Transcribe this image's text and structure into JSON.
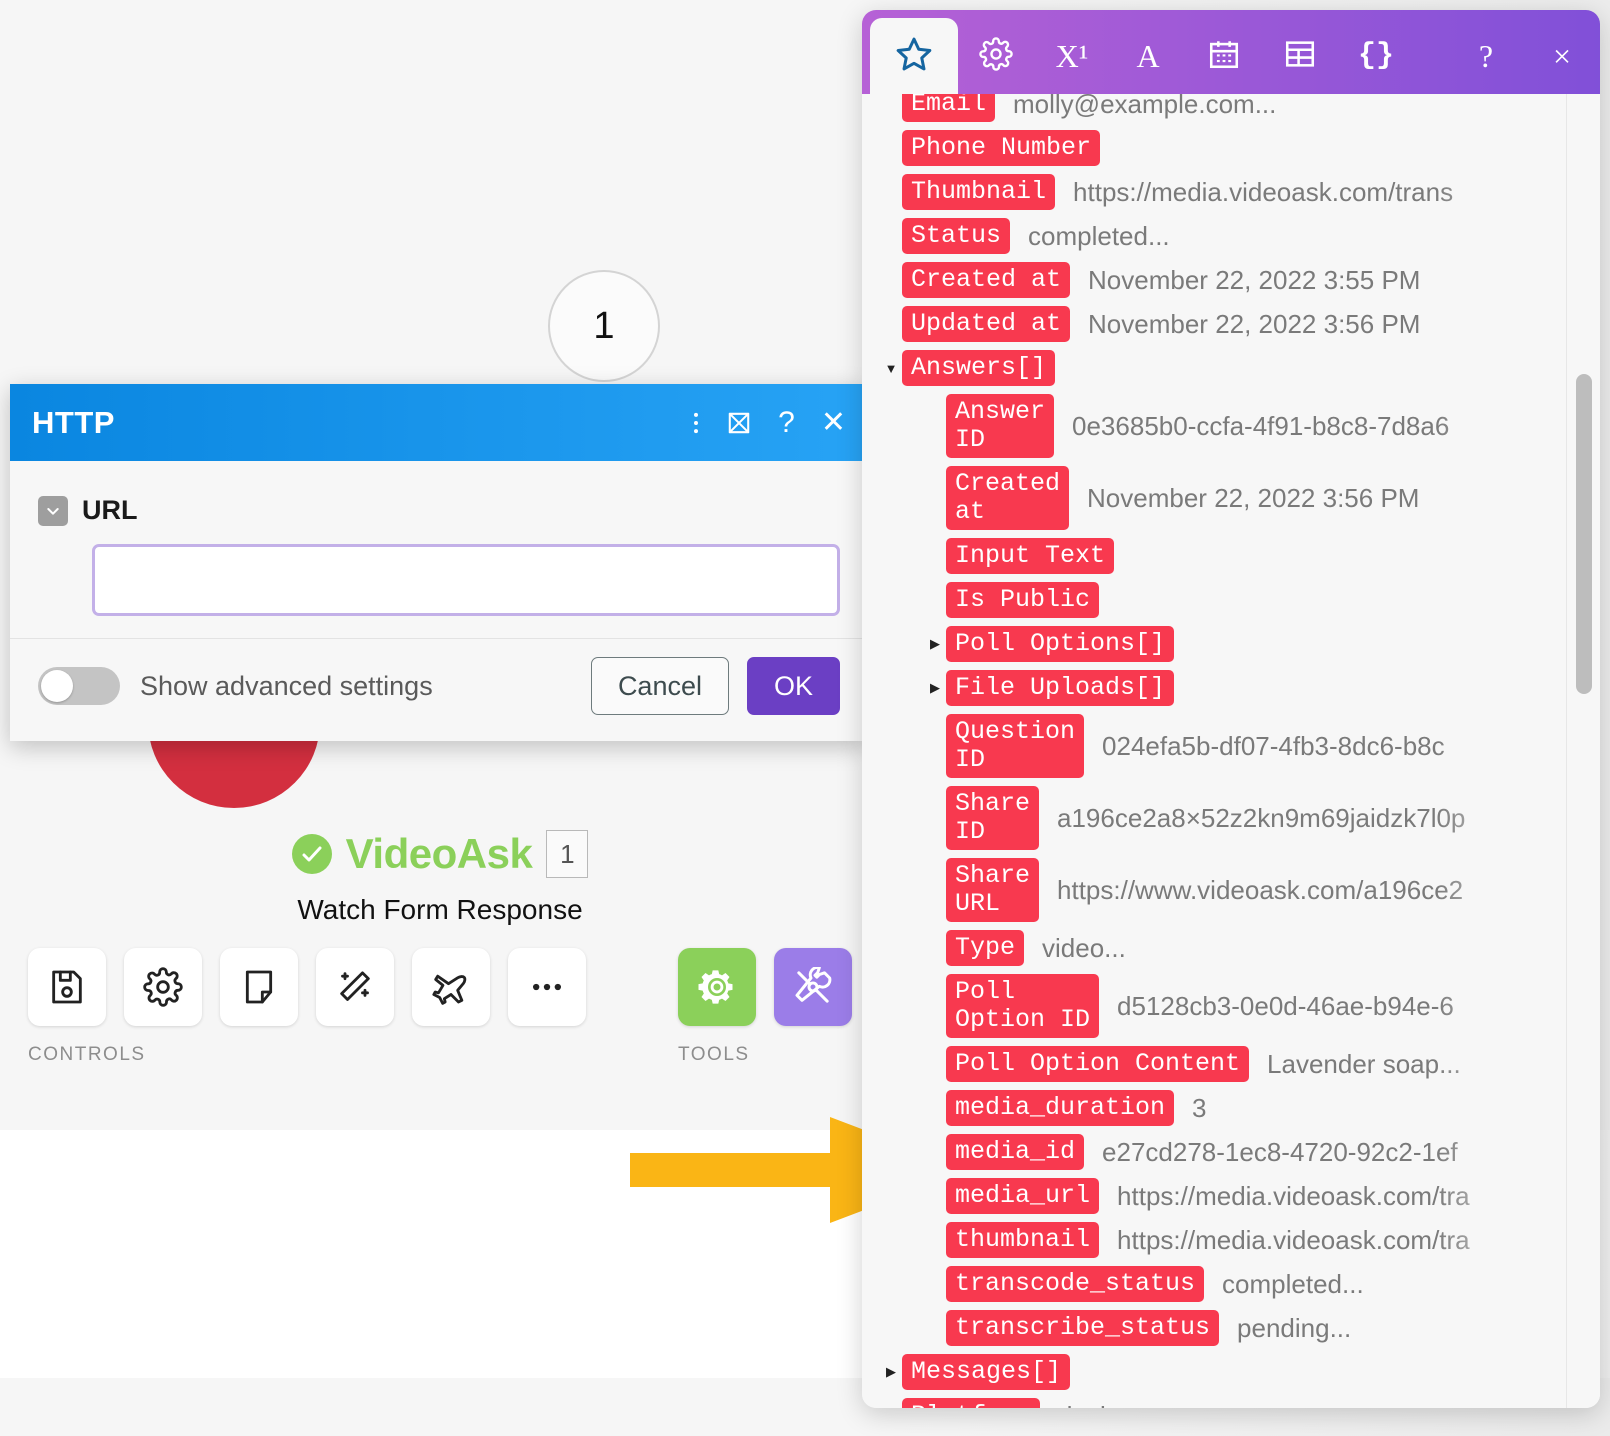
{
  "canvas": {
    "node_number": "1",
    "module": {
      "status_icon": "check-circle-icon",
      "name": "VideoAsk",
      "index": "1",
      "subtitle": "Watch Form Response",
      "controls_label": "CONTROLS",
      "tools_label": "TOOLS",
      "control_icons": [
        {
          "name": "save-icon",
          "label": "Save"
        },
        {
          "name": "gear-icon",
          "label": "Settings"
        },
        {
          "name": "note-icon",
          "label": "Note"
        },
        {
          "name": "magic-wand-icon",
          "label": "Auto-align"
        },
        {
          "name": "airplane-icon",
          "label": "Run this module only"
        },
        {
          "name": "more-ellipsis-icon",
          "label": "More"
        }
      ],
      "tool_icons": [
        {
          "name": "gear-tool-icon",
          "label": "Tools",
          "color": "#8bd05a"
        },
        {
          "name": "wrench-screwdriver-icon",
          "label": "Tools",
          "color": "#9b7de8"
        }
      ]
    }
  },
  "dialog": {
    "title": "HTTP",
    "header_icons": [
      {
        "name": "kebab-menu-icon",
        "label": "More options"
      },
      {
        "name": "expand-icon",
        "label": "Expand"
      },
      {
        "name": "help-question-icon",
        "label": "Help"
      },
      {
        "name": "close-icon",
        "label": "Close"
      }
    ],
    "url_field": {
      "label": "URL",
      "value": "",
      "placeholder": ""
    },
    "advanced_toggle_label": "Show advanced settings",
    "advanced_toggle_on": false,
    "cancel_label": "Cancel",
    "ok_label": "OK",
    "accent_color": "#6b3fc4",
    "header_color": "#0a86e0"
  },
  "panel": {
    "tabs": [
      {
        "name": "star-icon",
        "label": "Favorites",
        "active": true
      },
      {
        "name": "gear-icon",
        "label": "General functions",
        "active": false
      },
      {
        "name": "math-icon",
        "label": "X¹",
        "active": false
      },
      {
        "name": "text-icon",
        "label": "A",
        "active": false
      },
      {
        "name": "calendar-icon",
        "label": "Date & time",
        "active": false
      },
      {
        "name": "table-icon",
        "label": "Array",
        "active": false
      },
      {
        "name": "braces-icon",
        "label": "{}",
        "active": false
      },
      {
        "name": "help-question-icon",
        "label": "?",
        "active": false
      },
      {
        "name": "close-icon",
        "label": "×",
        "active": false
      }
    ],
    "accent_color": "#8150d8",
    "tag_color": "#f8394f",
    "tree": [
      {
        "indent": 1,
        "twisty": "",
        "tag": "Email",
        "value": "molly@example.com...",
        "partial": true
      },
      {
        "indent": 1,
        "twisty": "",
        "tag": "Phone Number",
        "value": ""
      },
      {
        "indent": 1,
        "twisty": "",
        "tag": "Thumbnail",
        "value": "https://media.videoask.com/trans"
      },
      {
        "indent": 1,
        "twisty": "",
        "tag": "Status",
        "value": "completed..."
      },
      {
        "indent": 1,
        "twisty": "",
        "tag": "Created at",
        "value": "November 22, 2022 3:55 PM"
      },
      {
        "indent": 1,
        "twisty": "",
        "tag": "Updated at",
        "value": "November 22, 2022 3:56 PM"
      },
      {
        "indent": 1,
        "twisty": "down",
        "tag": "Answers[]",
        "value": ""
      },
      {
        "indent": 2,
        "twisty": "",
        "tag": "Answer\nID",
        "value": "0e3685b0-ccfa-4f91-b8c8-7d8a6"
      },
      {
        "indent": 2,
        "twisty": "",
        "tag": "Created\nat",
        "value": "November 22, 2022 3:56 PM"
      },
      {
        "indent": 2,
        "twisty": "",
        "tag": "Input Text",
        "value": ""
      },
      {
        "indent": 2,
        "twisty": "",
        "tag": "Is Public",
        "value": ""
      },
      {
        "indent": 2,
        "twisty": "right",
        "tag": "Poll Options[]",
        "value": ""
      },
      {
        "indent": 2,
        "twisty": "right",
        "tag": "File Uploads[]",
        "value": ""
      },
      {
        "indent": 2,
        "twisty": "",
        "tag": "Question\nID",
        "value": "024efa5b-df07-4fb3-8dc6-b8c"
      },
      {
        "indent": 2,
        "twisty": "",
        "tag": "Share\nID",
        "value": "a196ce2a8×52z2kn9m69jaidzk7l0p"
      },
      {
        "indent": 2,
        "twisty": "",
        "tag": "Share\nURL",
        "value": "https://www.videoask.com/a196ce2"
      },
      {
        "indent": 2,
        "twisty": "",
        "tag": "Type",
        "value": "video..."
      },
      {
        "indent": 2,
        "twisty": "",
        "tag": "Poll\nOption ID",
        "value": "d5128cb3-0e0d-46ae-b94e-6"
      },
      {
        "indent": 2,
        "twisty": "",
        "tag": "Poll Option Content",
        "value": "Lavender soap..."
      },
      {
        "indent": 2,
        "twisty": "",
        "tag": "media_duration",
        "value": "3"
      },
      {
        "indent": 2,
        "twisty": "",
        "tag": "media_id",
        "value": "e27cd278-1ec8-4720-92c2-1ef"
      },
      {
        "indent": 2,
        "twisty": "",
        "tag": "media_url",
        "value": "https://media.videoask.com/tra"
      },
      {
        "indent": 2,
        "twisty": "",
        "tag": "thumbnail",
        "value": "https://media.videoask.com/tra"
      },
      {
        "indent": 2,
        "twisty": "",
        "tag": "transcode_status",
        "value": "completed..."
      },
      {
        "indent": 2,
        "twisty": "",
        "tag": "transcribe_status",
        "value": "pending..."
      },
      {
        "indent": 1,
        "twisty": "right",
        "tag": "Messages[]",
        "value": ""
      },
      {
        "indent": 1,
        "twisty": "",
        "tag": "Platform",
        "value": "desktop..."
      }
    ]
  },
  "annotation": {
    "arrow": {
      "name": "highlight-arrow",
      "color": "#FAB515",
      "direction": "right"
    }
  }
}
